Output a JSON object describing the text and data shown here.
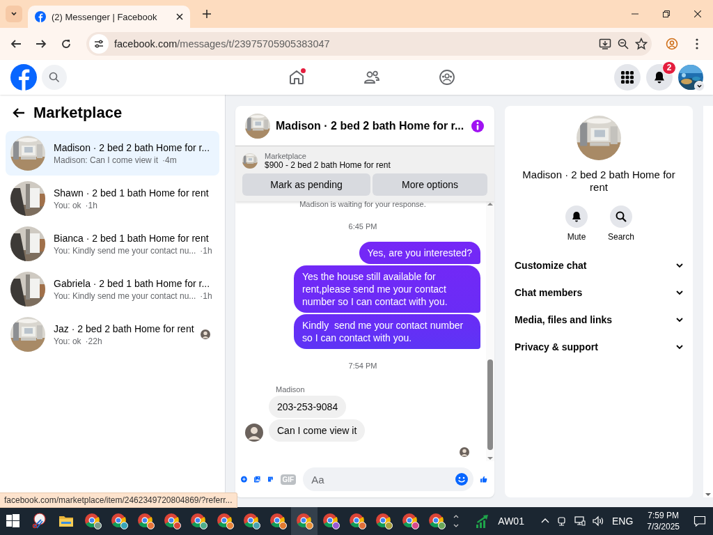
{
  "browser": {
    "tab_title": "(2) Messenger | Facebook",
    "url_domain": "facebook.com",
    "url_path": "/messages/t/23975705905383047"
  },
  "top_nav": {
    "home_unseen": true,
    "notification_count": "2"
  },
  "sidebar": {
    "title": "Marketplace",
    "conversations": [
      {
        "title": "Madison · 2 bed 2 bath Home for r...",
        "preview": "Madison: Can I come view it",
        "time": "·4m",
        "selected": true,
        "seen_avatar": false
      },
      {
        "title": "Shawn · 2 bed 1 bath Home for rent",
        "preview": "You: ok",
        "time": "·1h",
        "selected": false,
        "seen_avatar": false
      },
      {
        "title": "Bianca · 2 bed 1 bath Home for rent",
        "preview": "You: Kindly send me your contact nu...",
        "time": "·1h",
        "selected": false,
        "seen_avatar": false
      },
      {
        "title": "Gabriela · 2 bed 1 bath Home for r...",
        "preview": "You: Kindly send me your contact nu...",
        "time": "·1h",
        "selected": false,
        "seen_avatar": false
      },
      {
        "title": "Jaz · 2 bed 2 bath Home for rent",
        "preview": "You: ok",
        "time": "·22h",
        "selected": false,
        "seen_avatar": true
      }
    ]
  },
  "chat": {
    "title": "Madison · 2 bed 2 bath Home for r...",
    "listing": {
      "label": "Marketplace",
      "title": "$900 - 2 bed 2 bath Home for rent"
    },
    "buttons": [
      "Mark as pending",
      "More options"
    ],
    "messages": [
      {
        "kind": "notice",
        "text": "Madison is waiting for your response."
      },
      {
        "kind": "time",
        "text": "6:45 PM"
      },
      {
        "kind": "outgoing",
        "text": "Yes, are you interested?"
      },
      {
        "kind": "outgoing",
        "text": "Yes the house still available for rent,please send me your contact number so I can contact with you."
      },
      {
        "kind": "outgoing",
        "text": "Kindly  send me your contact number so I can contact with you."
      },
      {
        "kind": "time",
        "text": "7:54 PM"
      },
      {
        "kind": "sender",
        "text": "Madison"
      },
      {
        "kind": "incoming",
        "text": "203-253-9084",
        "avatar": false
      },
      {
        "kind": "incoming",
        "text": "Can I come view it",
        "avatar": true
      },
      {
        "kind": "seen"
      }
    ],
    "composer": {
      "gif_label": "GIF",
      "placeholder": "Aa"
    }
  },
  "details": {
    "title": "Madison · 2 bed 2 bath Home for rent",
    "actions": [
      {
        "kind": "bell",
        "label": "Mute"
      },
      {
        "kind": "search",
        "label": "Search"
      }
    ],
    "sections": [
      {
        "label": "Customize chat",
        "expanded": false
      },
      {
        "label": "Chat members",
        "expanded": false
      },
      {
        "label": "Media, files and links",
        "expanded": false
      },
      {
        "label": "Privacy & support",
        "expanded": false
      }
    ]
  },
  "status_url": "facebook.com/marketplace/item/2462349720804869/?referr...",
  "taskbar": {
    "apps": [
      {
        "kind": "start",
        "selected": false
      },
      {
        "kind": "snip",
        "selected": false
      },
      {
        "kind": "folder",
        "selected": false
      },
      {
        "kind": "browser",
        "color": "#7a9a8a",
        "selected": false
      },
      {
        "kind": "browser",
        "color": "#3aa6b8",
        "selected": false
      },
      {
        "kind": "browser",
        "color": "#e8743b",
        "selected": false
      },
      {
        "kind": "browser",
        "color": "#d8453a",
        "selected": false
      },
      {
        "kind": "browser",
        "color": "#4fae8c",
        "selected": false
      },
      {
        "kind": "browser",
        "color": "#e8843b",
        "selected": false
      },
      {
        "kind": "browser",
        "color": "#4aa0b0",
        "selected": false
      },
      {
        "kind": "browser",
        "color": "#e07a30",
        "selected": false
      },
      {
        "kind": "browser",
        "color": "#e8903b",
        "selected": true
      },
      {
        "kind": "browser",
        "color": "#9a5ad0",
        "selected": false
      },
      {
        "kind": "browser",
        "color": "#e0703a",
        "selected": false
      },
      {
        "kind": "browser",
        "color": "#a8a040",
        "selected": false
      },
      {
        "kind": "browser",
        "color": "#d84a8a",
        "selected": false
      },
      {
        "kind": "browser",
        "color": "#6aa85a",
        "selected": false
      }
    ],
    "widget_label": "AW01",
    "language": "ENG",
    "time": "7:59 PM",
    "date": "7/3/2025"
  }
}
